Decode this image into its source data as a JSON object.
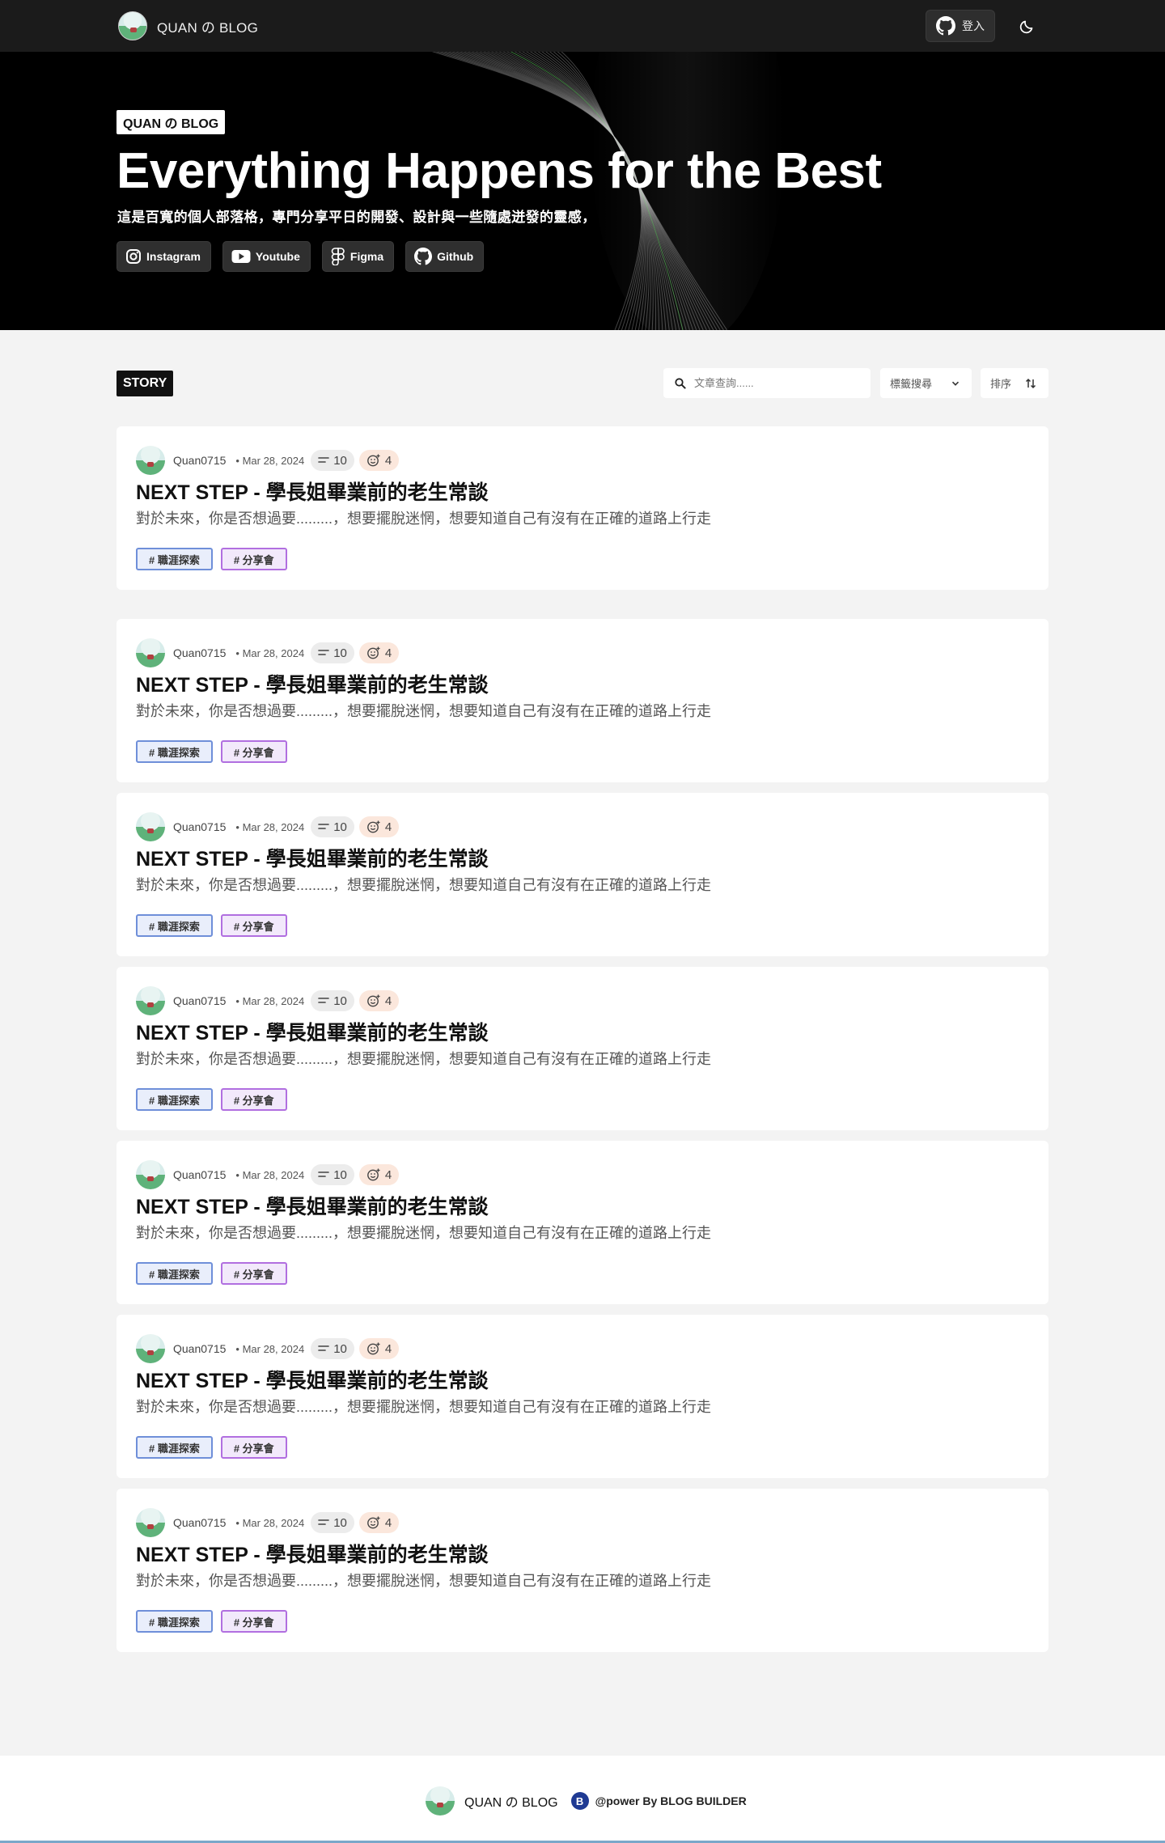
{
  "nav": {
    "brand": "QUAN の BLOG",
    "login_label": "登入",
    "github_icon": "github-icon",
    "theme_icon": "moon-icon"
  },
  "hero": {
    "badge": "QUAN の BLOG",
    "title": "Everything Happens for the Best",
    "subtitle": "這是百寬的個人部落格，專門分享平日的開發、設計與一些隨處迸發的靈感，",
    "socials": [
      {
        "label": "Instagram",
        "icon": "instagram-icon"
      },
      {
        "label": "Youtube",
        "icon": "youtube-icon"
      },
      {
        "label": "Figma",
        "icon": "figma-icon"
      },
      {
        "label": "Github",
        "icon": "github-icon"
      }
    ]
  },
  "toolbar": {
    "section_tag": "STORY",
    "search_placeholder": "文章查詢......",
    "tag_filter_label": "標籤搜尋",
    "sort_label": "排序"
  },
  "posts": [
    {
      "author": "Quan0715",
      "date": "• Mar 28, 2024",
      "comments": "10",
      "reactions": "4",
      "title": "NEXT STEP - 學長姐畢業前的老生常談",
      "excerpt": "對於未來，你是否想過要.........，想要擺脫迷惘，想要知道自己有沒有在正確的道路上行走",
      "tags": [
        "# 職涯探索",
        "# 分享會"
      ]
    },
    {
      "author": "Quan0715",
      "date": "• Mar 28, 2024",
      "comments": "10",
      "reactions": "4",
      "title": "NEXT STEP - 學長姐畢業前的老生常談",
      "excerpt": "對於未來，你是否想過要.........，想要擺脫迷惘，想要知道自己有沒有在正確的道路上行走",
      "tags": [
        "# 職涯探索",
        "# 分享會"
      ]
    },
    {
      "author": "Quan0715",
      "date": "• Mar 28, 2024",
      "comments": "10",
      "reactions": "4",
      "title": "NEXT STEP - 學長姐畢業前的老生常談",
      "excerpt": "對於未來，你是否想過要.........，想要擺脫迷惘，想要知道自己有沒有在正確的道路上行走",
      "tags": [
        "# 職涯探索",
        "# 分享會"
      ]
    },
    {
      "author": "Quan0715",
      "date": "• Mar 28, 2024",
      "comments": "10",
      "reactions": "4",
      "title": "NEXT STEP - 學長姐畢業前的老生常談",
      "excerpt": "對於未來，你是否想過要.........，想要擺脫迷惘，想要知道自己有沒有在正確的道路上行走",
      "tags": [
        "# 職涯探索",
        "# 分享會"
      ]
    },
    {
      "author": "Quan0715",
      "date": "• Mar 28, 2024",
      "comments": "10",
      "reactions": "4",
      "title": "NEXT STEP - 學長姐畢業前的老生常談",
      "excerpt": "對於未來，你是否想過要.........，想要擺脫迷惘，想要知道自己有沒有在正確的道路上行走",
      "tags": [
        "# 職涯探索",
        "# 分享會"
      ]
    },
    {
      "author": "Quan0715",
      "date": "• Mar 28, 2024",
      "comments": "10",
      "reactions": "4",
      "title": "NEXT STEP - 學長姐畢業前的老生常談",
      "excerpt": "對於未來，你是否想過要.........，想要擺脫迷惘，想要知道自己有沒有在正確的道路上行走",
      "tags": [
        "# 職涯探索",
        "# 分享會"
      ]
    },
    {
      "author": "Quan0715",
      "date": "• Mar 28, 2024",
      "comments": "10",
      "reactions": "4",
      "title": "NEXT STEP - 學長姐畢業前的老生常談",
      "excerpt": "對於未來，你是否想過要.........，想要擺脫迷惘，想要知道自己有沒有在正確的道路上行走",
      "tags": [
        "# 職涯探索",
        "# 分享會"
      ]
    }
  ],
  "footer": {
    "brand": "QUAN の BLOG",
    "badge_letter": "B",
    "powered_by": "@power By BLOG BUILDER"
  },
  "colors": {
    "nav_bg": "#1b1b1b",
    "hero_bg": "#000000",
    "page_bg": "#f3f3f3",
    "tag_blue": "#6f8fd9",
    "tag_purple": "#b16fe0",
    "footer_badge": "#1f3a93"
  }
}
